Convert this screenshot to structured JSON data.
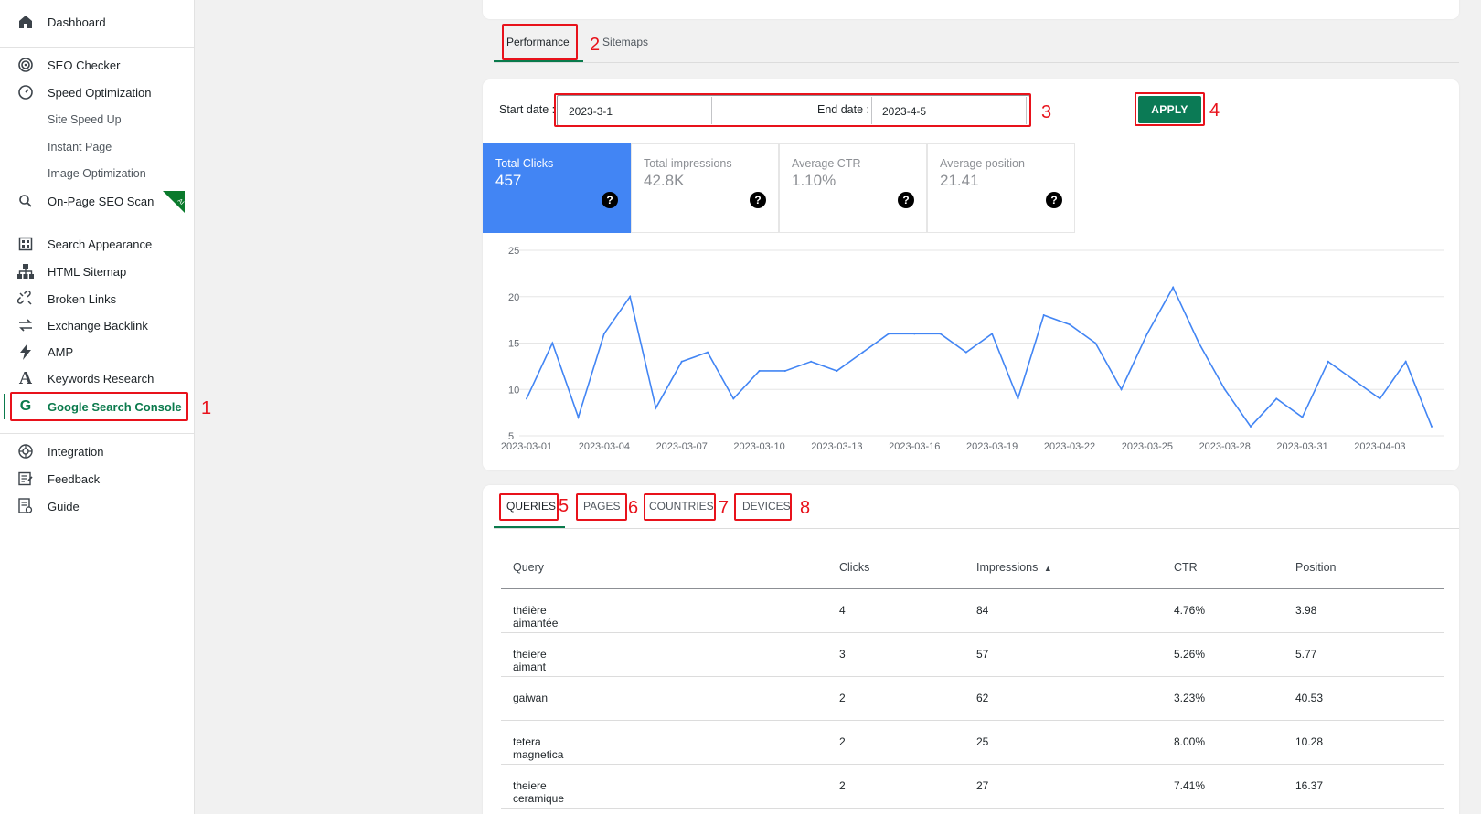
{
  "sidebar": {
    "dashboard": "Dashboard",
    "seo_checker": "SEO Checker",
    "speed_optimization": "Speed Optimization",
    "site_speed_up": "Site Speed Up",
    "instant_page": "Instant Page",
    "image_optimization": "Image Optimization",
    "onpage_seo_scan": "On-Page SEO Scan",
    "ai_badge": "AI",
    "search_appearance": "Search Appearance",
    "html_sitemap": "HTML Sitemap",
    "broken_links": "Broken Links",
    "exchange_backlink": "Exchange Backlink",
    "amp": "AMP",
    "keywords_research": "Keywords Research",
    "google_search_console": "Google Search Console",
    "integration": "Integration",
    "feedback": "Feedback",
    "guide": "Guide"
  },
  "annotations": [
    "1",
    "2",
    "3",
    "4",
    "5",
    "6",
    "7",
    "8"
  ],
  "top_tabs": {
    "performance": "Performance",
    "sitemaps": "Sitemaps"
  },
  "filters": {
    "start_label": "Start date :",
    "start_value": "2023-3-1",
    "end_label": "End date :",
    "end_value": "2023-4-5",
    "apply": "APPLY"
  },
  "metrics": [
    {
      "label": "Total Clicks",
      "value": "457"
    },
    {
      "label": "Total impressions",
      "value": "42.8K"
    },
    {
      "label": "Average CTR",
      "value": "1.10%"
    },
    {
      "label": "Average position",
      "value": "21.41"
    }
  ],
  "colors": {
    "accent": "#0a7a4c",
    "apply_bg": "#0b7a55",
    "metric_active": "#4285f4",
    "line": "#4285f4",
    "annotation": "#e8121b"
  },
  "chart_data": {
    "type": "line",
    "x": [
      "2023-03-01",
      "2023-03-02",
      "2023-03-03",
      "2023-03-04",
      "2023-03-05",
      "2023-03-06",
      "2023-03-07",
      "2023-03-08",
      "2023-03-09",
      "2023-03-10",
      "2023-03-11",
      "2023-03-12",
      "2023-03-13",
      "2023-03-14",
      "2023-03-15",
      "2023-03-16",
      "2023-03-17",
      "2023-03-18",
      "2023-03-19",
      "2023-03-20",
      "2023-03-21",
      "2023-03-22",
      "2023-03-23",
      "2023-03-24",
      "2023-03-25",
      "2023-03-26",
      "2023-03-27",
      "2023-03-28",
      "2023-03-29",
      "2023-03-30",
      "2023-03-31",
      "2023-04-01",
      "2023-04-02",
      "2023-04-03",
      "2023-04-04",
      "2023-04-05"
    ],
    "series": [
      {
        "values": [
          9,
          15,
          7,
          16,
          20,
          8,
          13,
          14,
          9,
          12,
          12,
          13,
          12,
          14,
          16,
          16,
          16,
          14,
          16,
          9,
          18,
          17,
          15,
          10,
          16,
          21,
          15,
          10,
          6,
          9,
          7,
          13,
          11,
          9,
          13,
          6
        ]
      }
    ],
    "xticks": [
      "2023-03-01",
      "2023-03-04",
      "2023-03-07",
      "2023-03-10",
      "2023-03-13",
      "2023-03-16",
      "2023-03-19",
      "2023-03-22",
      "2023-03-25",
      "2023-03-28",
      "2023-03-31",
      "2023-04-03"
    ],
    "yticks": [
      "5",
      "10",
      "15",
      "20",
      "25"
    ],
    "ylim": [
      5,
      25
    ],
    "grid": true
  },
  "sub_tabs": [
    "QUERIES",
    "PAGES",
    "COUNTRIES",
    "DEVICES"
  ],
  "table": {
    "headers": [
      "Query",
      "Clicks",
      "Impressions",
      "CTR",
      "Position"
    ],
    "sort_indicator": "▲",
    "rows": [
      [
        "théière aimantée",
        "4",
        "84",
        "4.76%",
        "3.98"
      ],
      [
        "theiere aimant",
        "3",
        "57",
        "5.26%",
        "5.77"
      ],
      [
        "gaiwan",
        "2",
        "62",
        "3.23%",
        "40.53"
      ],
      [
        "tetera magnetica",
        "2",
        "25",
        "8.00%",
        "10.28"
      ],
      [
        "theiere ceramique",
        "2",
        "27",
        "7.41%",
        "16.37"
      ]
    ]
  }
}
